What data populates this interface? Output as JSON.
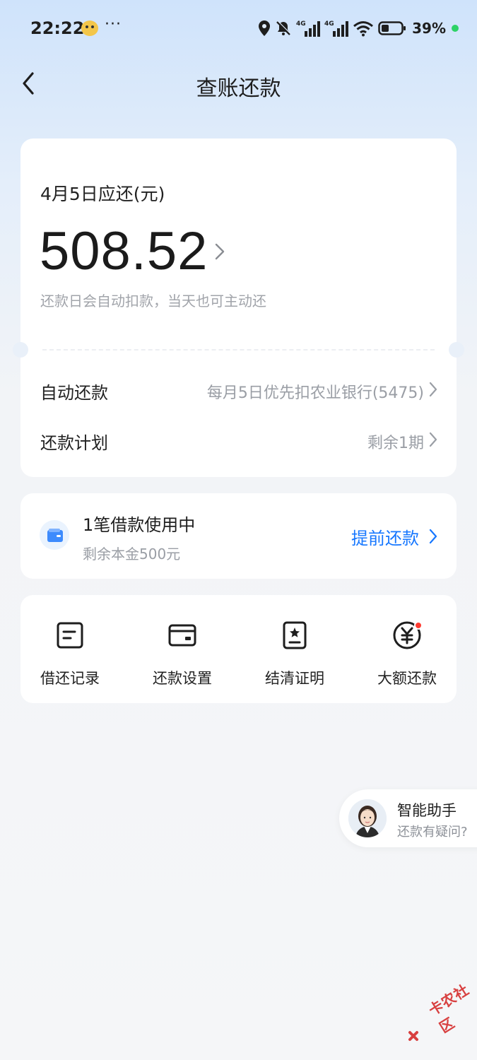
{
  "status_bar": {
    "time": "22:22",
    "more": "···",
    "battery_percent": "39%"
  },
  "nav": {
    "title": "查账还款"
  },
  "due_card": {
    "label": "4月5日应还(元)",
    "amount": "508.52",
    "note": "还款日会自动扣款，当天也可主动还",
    "rows": [
      {
        "label": "自动还款",
        "value": "每月5日优先扣农业银行(5475)"
      },
      {
        "label": "还款计划",
        "value": "剩余1期"
      }
    ]
  },
  "loan_card": {
    "title": "1笔借款使用中",
    "subtitle": "剩余本金500元",
    "action": "提前还款"
  },
  "shortcuts": [
    {
      "label": "借还记录",
      "icon": "record-icon"
    },
    {
      "label": "还款设置",
      "icon": "card-settings-icon"
    },
    {
      "label": "结清证明",
      "icon": "certificate-icon"
    },
    {
      "label": "大额还款",
      "icon": "yuan-coin-icon"
    }
  ],
  "assistant": {
    "title": "智能助手",
    "subtitle": "还款有疑问?"
  },
  "watermark": {
    "text": "卡农社区"
  },
  "colors": {
    "accent": "#1677ff",
    "badge": "#ff3b30"
  }
}
